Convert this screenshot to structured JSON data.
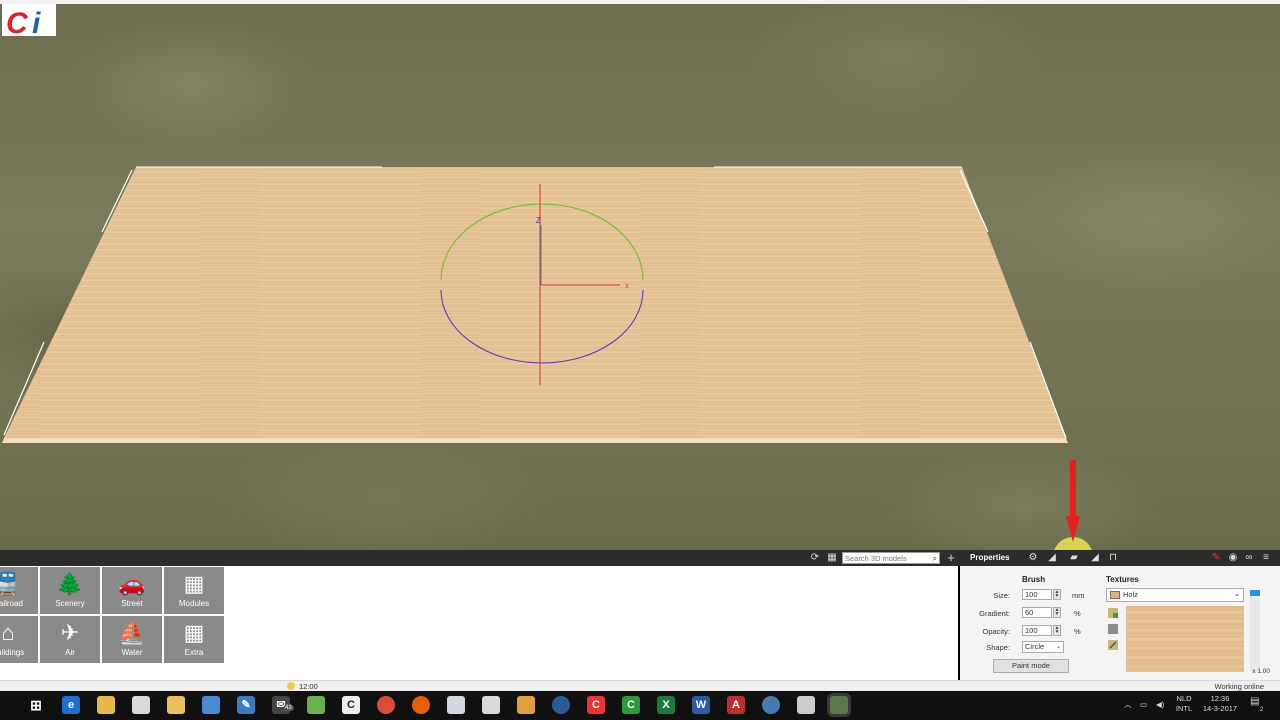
{
  "viewport": {
    "label": "3D viewport",
    "gizmo_axis_label": "Z",
    "gizmo_x_label": "x"
  },
  "logo": {
    "text": "Ci",
    "colors": {
      "c": "#e0202a",
      "i": "#1e5fb0"
    }
  },
  "panel_bar": {
    "search_placeholder": "Search 3D models",
    "search_icon": "magnifier-icon",
    "properties_label": "Properties"
  },
  "categories": [
    {
      "label": "Railroad",
      "icon": "train-icon",
      "glyph": "🚆"
    },
    {
      "label": "Scenery",
      "icon": "tree-icon",
      "glyph": "🌲"
    },
    {
      "label": "Street",
      "icon": "car-icon",
      "glyph": "🚗"
    },
    {
      "label": "Modules",
      "icon": "grid-icon",
      "glyph": "▦"
    },
    {
      "label": "Buildings",
      "icon": "house-icon",
      "glyph": "⌂"
    },
    {
      "label": "Air",
      "icon": "airplane-icon",
      "glyph": "✈"
    },
    {
      "label": "Water",
      "icon": "sailboat-icon",
      "glyph": "⛵"
    },
    {
      "label": "Extra",
      "icon": "grid-icon",
      "glyph": "▦"
    }
  ],
  "brush": {
    "header": "Brush",
    "size_label": "Size:",
    "size_value": "100",
    "size_unit": "mm",
    "gradient_label": "Gradient:",
    "gradient_value": "60",
    "gradient_unit": "%",
    "opacity_label": "Opacity:",
    "opacity_value": "100",
    "opacity_unit": "%",
    "shape_label": "Shape:",
    "shape_value": "Circle",
    "paint_mode_label": "Paint mode"
  },
  "textures": {
    "header": "Textures",
    "selected": "Holz",
    "zoom": "x 1.00"
  },
  "status": {
    "time": "12:00",
    "online": "Working online"
  },
  "taskbar": {
    "mail_badge": "43",
    "lang": "NLD",
    "layout": "INTL",
    "clock_time": "12:36",
    "clock_date": "14-3-2017",
    "notif_count": "2"
  },
  "colors": {
    "accent_blue": "#2b8fd6",
    "arrow_red": "#e61e1e",
    "cursor_highlight": "#fff550"
  }
}
